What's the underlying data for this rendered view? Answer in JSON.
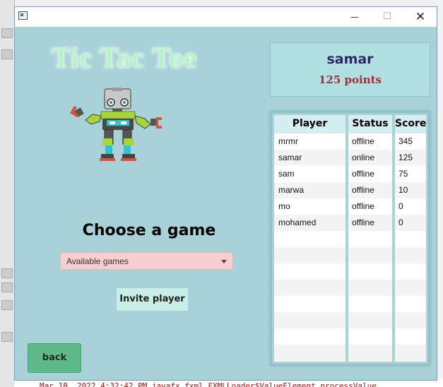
{
  "background": {
    "log_text": "Mar 18, 2022 4:32:42 PM javafx.fxml.FXMLLoader$ValueElement processValue"
  },
  "window": {
    "title": "",
    "controls": {
      "minimize": "—",
      "maximize": "☐",
      "close": "✕"
    }
  },
  "app": {
    "title": "Tic Tac Toe",
    "mascot_icon": "robot-icon",
    "user": {
      "name": "samar",
      "points": "125 points"
    },
    "choose_label": "Choose a game",
    "game_select": {
      "selected": "Available games",
      "options": [
        "Available games"
      ]
    },
    "invite_label": "Invite player",
    "back_label": "back"
  },
  "table": {
    "columns": [
      "Player",
      "Status",
      "Score"
    ],
    "rows": [
      {
        "player": "mrmr",
        "status": "offline",
        "score": "345"
      },
      {
        "player": "samar",
        "status": "online",
        "score": "125"
      },
      {
        "player": "sam",
        "status": "offline",
        "score": "75"
      },
      {
        "player": "marwa",
        "status": "offline",
        "score": "10"
      },
      {
        "player": "mo",
        "status": "offline",
        "score": "0"
      },
      {
        "player": "mohamed",
        "status": "offline",
        "score": "0"
      }
    ]
  },
  "colors": {
    "content_bg": "#a9d2d8",
    "title": "#b5f3c9",
    "user_name": "#2f246a",
    "user_points": "#9c3037",
    "select_bg": "#f7cfd0",
    "invite_bg": "#c9eee7",
    "back_bg": "#5fba89"
  }
}
